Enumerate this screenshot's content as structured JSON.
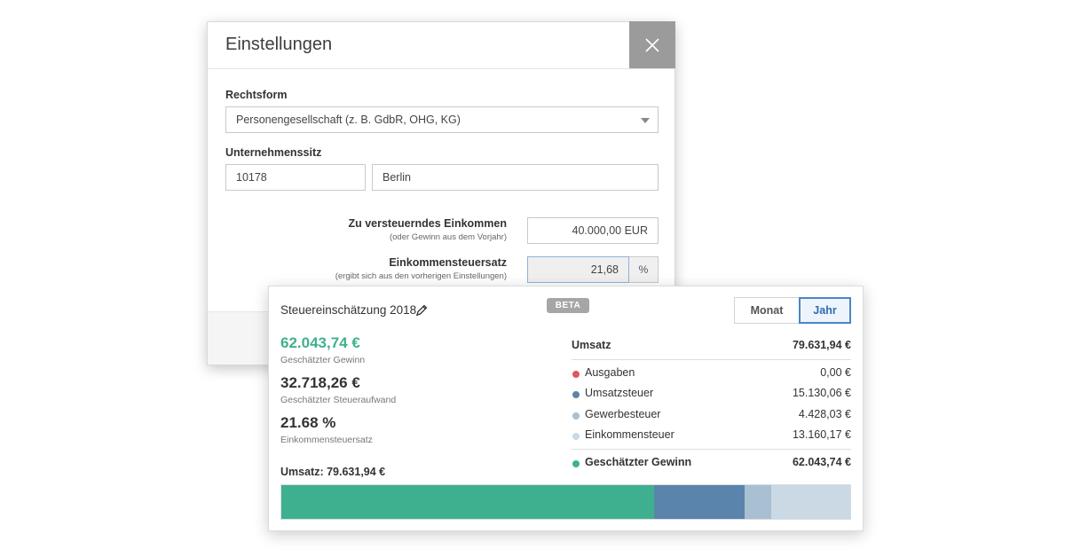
{
  "dialog": {
    "title": "Einstellungen",
    "rechtsform_label": "Rechtsform",
    "rechtsform_value": "Personengesellschaft (z. B. GdbR, OHG, KG)",
    "sitz_label": "Unternehmenssitz",
    "plz_value": "10178",
    "city_value": "Berlin",
    "income_label": "Zu versteuerndes Einkommen",
    "income_sub": "(oder Gewinn aus dem Vorjahr)",
    "income_value": "40.000,00 EUR",
    "rate_label": "Einkommensteuersatz",
    "rate_sub": "(ergibt sich aus den vorherigen Einstellungen)",
    "rate_value": "21,68",
    "rate_unit": "%"
  },
  "card": {
    "title": "Steuereinschätzung 2018",
    "badge": "BETA",
    "toggle": {
      "monat": "Monat",
      "jahr": "Jahr",
      "selected": "Jahr"
    },
    "metrics": [
      {
        "value": "62.043,74 €",
        "label": "Geschätzter Gewinn",
        "color": "#3fb08f"
      },
      {
        "value": "32.718,26 €",
        "label": "Geschätzter Steueraufwand",
        "color": "#333333"
      },
      {
        "value": "21.68 %",
        "label": "Einkommensteuersatz",
        "color": "#333333"
      }
    ],
    "umsatz_caption": "Umsatz: 79.631,94 €",
    "breakdown": {
      "header": {
        "label": "Umsatz",
        "value": "79.631,94 €"
      },
      "items": [
        {
          "label": "Ausgaben",
          "value": "0,00 €",
          "color": "#e05563"
        },
        {
          "label": "Umsatzsteuer",
          "value": "15.130,06 €",
          "color": "#5a84ab"
        },
        {
          "label": "Gewerbesteuer",
          "value": "4.428,03 €",
          "color": "#a9bfd2"
        },
        {
          "label": "Einkommensteuer",
          "value": "13.160,17 €",
          "color": "#cbd9e5"
        }
      ],
      "total": {
        "label": "Geschätzter Gewinn",
        "value": "62.043,74 €",
        "color": "#3fb08f"
      }
    },
    "bar_amounts": [
      {
        "name": "Geschätzter Gewinn",
        "amount": 62043.74,
        "color": "#3fb08f"
      },
      {
        "name": "Umsatzsteuer",
        "amount": 15130.06,
        "color": "#5a84ab"
      },
      {
        "name": "Gewerbesteuer",
        "amount": 4428.03,
        "color": "#a9bfd2"
      },
      {
        "name": "Einkommensteuer",
        "amount": 13160.17,
        "color": "#cbd9e5"
      }
    ]
  }
}
